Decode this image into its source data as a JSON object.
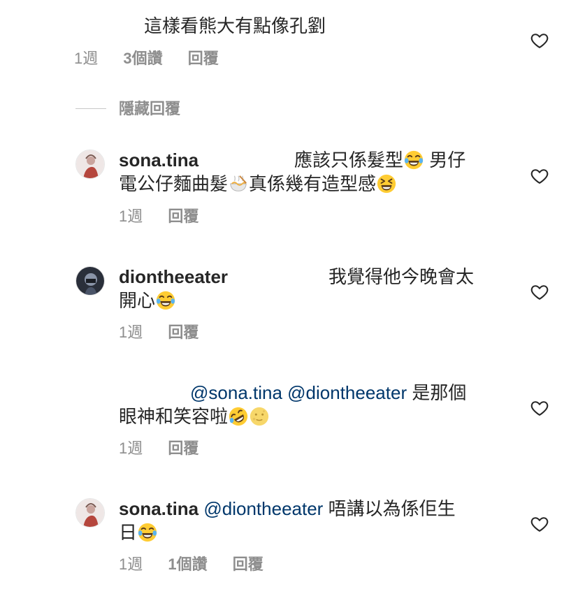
{
  "comments": [
    {
      "username": "",
      "text": "這樣看熊大有點像孔劉",
      "time": "1週",
      "likes": "3個讚",
      "reply": "回覆"
    },
    {
      "username": "sona.tina",
      "text_line1": "應該只係髮型",
      "text_line1_after": " 男仔",
      "text_line2": "電公仔麵曲髮",
      "text_line2_after": "真係幾有造型感",
      "time": "1週",
      "reply": "回覆"
    },
    {
      "username": "diontheeater",
      "text_line1": "我覺得他今晚會太",
      "text_line2": "開心",
      "time": "1週",
      "reply": "回覆"
    },
    {
      "username": "",
      "mention1": "@sona.tina",
      "mention2": "@diontheeater",
      "text_line1": " 是那個",
      "text_line2": "眼神和笑容啦",
      "time": "1週",
      "reply": "回覆"
    },
    {
      "username": "sona.tina",
      "mention": "@diontheeater",
      "text_line1": " 唔講以為係佢生",
      "text_line2": "日",
      "time": "1週",
      "likes": "1個讚",
      "reply": "回覆"
    }
  ],
  "hidden_replies": "隱藏回覆",
  "icons": {
    "heart": "heart-outline-icon",
    "emoji_joy": "face-with-tears-of-joy-icon",
    "emoji_noodle": "steaming-bowl-icon",
    "emoji_laugh": "grinning-squinting-face-icon",
    "emoji_rofl": "rolling-on-floor-laughing-icon",
    "emoji_moon": "full-moon-face-icon"
  },
  "colors": {
    "text": "#262626",
    "meta": "#8e8e8e",
    "mention": "#00376b",
    "emoji": "#ffcc33"
  }
}
